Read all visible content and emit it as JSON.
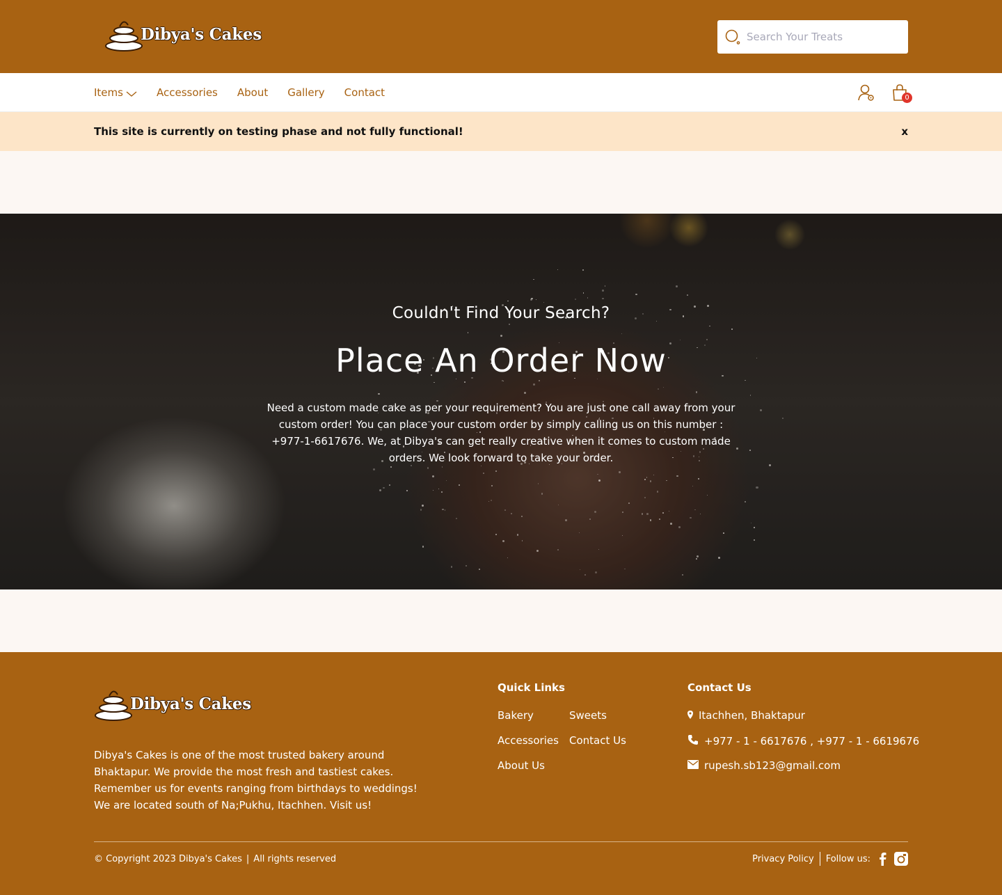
{
  "brand": {
    "name": "Dibya's Cakes"
  },
  "search": {
    "placeholder": "Search Your Treats"
  },
  "nav": {
    "items": [
      {
        "label": "Items"
      },
      {
        "label": "Accessories"
      },
      {
        "label": "About"
      },
      {
        "label": "Gallery"
      },
      {
        "label": "Contact"
      }
    ],
    "cart_count": "0"
  },
  "notice": {
    "text": "This site is currently on testing phase and not fully functional!",
    "close": "x"
  },
  "hero": {
    "subtitle": "Couldn't Find Your Search?",
    "title": "Place An Order Now",
    "text": "Need a custom made cake as per your requirement? You are just one call away from your custom order! You can place your custom order by simply calling us on this number : +977-1-6617676. We, at Dibya's can get really creative when it comes to custom made orders. We look forward to take your order."
  },
  "footer": {
    "description": "Dibya's Cakes is one of the most trusted bakery around Bhaktapur. We provide the most fresh and tastiest cakes. Remember us for events ranging from birthdays to weddings! We are located south of Na;Pukhu, Itachhen. Visit us!",
    "quick_links_title": "Quick Links",
    "quick_links": [
      "Bakery",
      "Sweets",
      "Accessories",
      "Contact Us",
      "About Us"
    ],
    "contact_title": "Contact Us",
    "address": "Itachhen, Bhaktapur",
    "phone": "+977 - 1 - 6617676 , +977 - 1 - 6619676",
    "email": "rupesh.sb123@gmail.com",
    "copyright": "© Copyright 2023 Dibya's Cakes",
    "rights": "All rights reserved",
    "privacy": "Privacy Policy",
    "follow": "Follow us:"
  },
  "colors": {
    "brand_brown": "#a86212",
    "notice_bg": "#fde5c8",
    "page_bg": "#fcf7f3",
    "badge_red": "#e0352b"
  },
  "icons": [
    "search-icon",
    "chevron-down-icon",
    "user-settings-icon",
    "shopping-bag-icon",
    "location-pin-icon",
    "phone-icon",
    "mail-icon",
    "facebook-icon",
    "instagram-icon"
  ]
}
